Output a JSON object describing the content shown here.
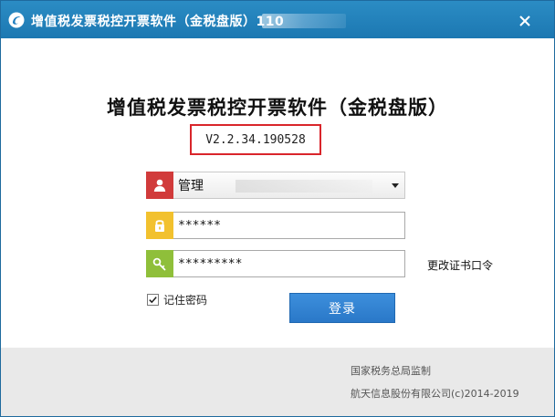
{
  "window": {
    "title": "增值税发票税控开票软件（金税盘版）110",
    "close_icon": "close-icon",
    "logo_icon": "app-logo-icon"
  },
  "main": {
    "heading": "增值税发票税控开票软件（金税盘版）",
    "version": "V2.2.34.190528"
  },
  "form": {
    "user": {
      "icon": "user-icon",
      "selected": "管理"
    },
    "password": {
      "icon": "lock-icon",
      "value": "******"
    },
    "cert_password": {
      "icon": "key-icon",
      "value": "*********"
    },
    "change_cert_label": "更改证书口令",
    "remember_label": "记住密码",
    "remember_checked": true,
    "login_label": "登录"
  },
  "footer": {
    "line1": "国家税务总局监制",
    "line2": "航天信息股份有限公司(c)2014-2019"
  },
  "colors": {
    "titlebar": "#2283bd",
    "user_icon_bg": "#d13b3b",
    "lock_icon_bg": "#f2c12e",
    "key_icon_bg": "#8fbf3a",
    "login_button": "#2f7fd0",
    "version_border": "#d9252b"
  }
}
